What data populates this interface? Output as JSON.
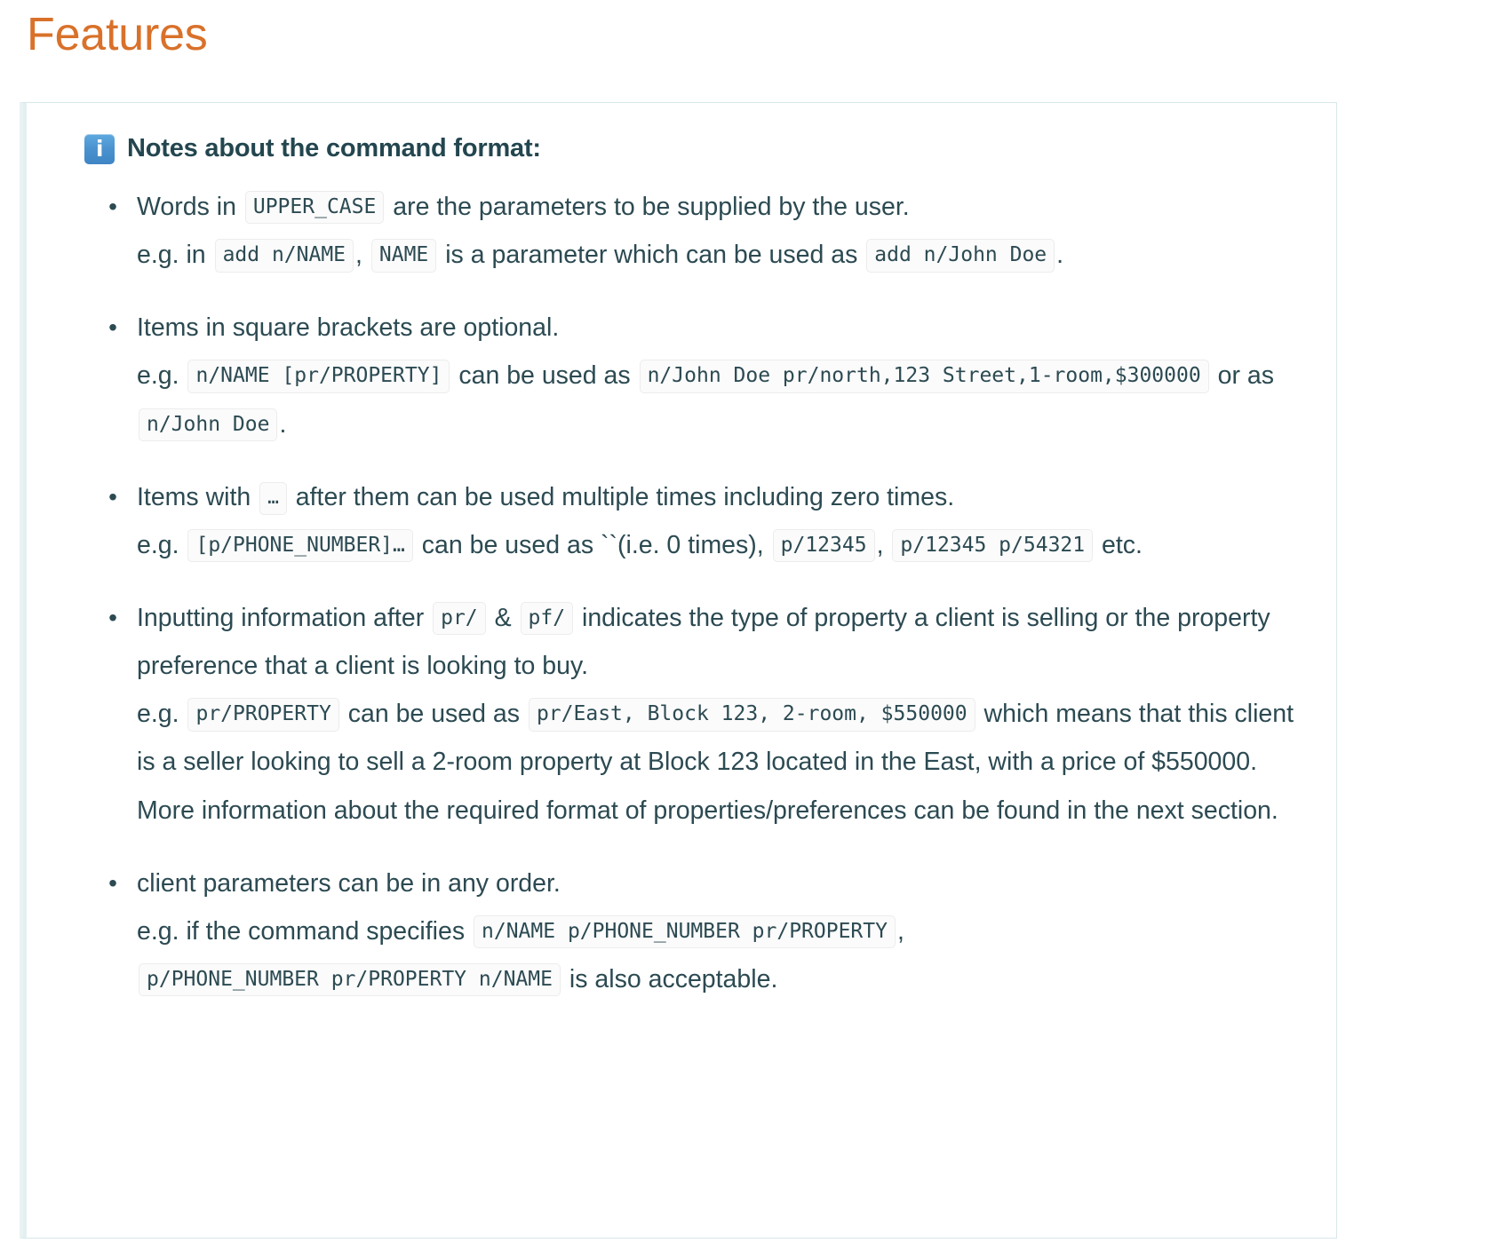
{
  "page_title": "Features",
  "callout": {
    "icon": "info-icon",
    "icon_glyph": "i",
    "title": "Notes about the command format:",
    "accent_color": "#d9712a",
    "text_color": "#2c4a52",
    "border_color": "#d7e8ea",
    "icon_color": "#4a92cf",
    "notes": [
      {
        "id": "upper-case",
        "lines": [
          {
            "parts": [
              {
                "t": "text",
                "v": "Words in "
              },
              {
                "t": "code",
                "v": "UPPER_CASE"
              },
              {
                "t": "text",
                "v": " are the parameters to be supplied by the user."
              }
            ]
          },
          {
            "parts": [
              {
                "t": "text",
                "v": "e.g. in "
              },
              {
                "t": "code",
                "v": "add n/NAME"
              },
              {
                "t": "text",
                "v": ", "
              },
              {
                "t": "code",
                "v": "NAME"
              },
              {
                "t": "text",
                "v": " is a parameter which can be used as "
              },
              {
                "t": "code",
                "v": "add n/John Doe"
              },
              {
                "t": "text",
                "v": "."
              }
            ]
          }
        ]
      },
      {
        "id": "optional-brackets",
        "lines": [
          {
            "parts": [
              {
                "t": "text",
                "v": "Items in square brackets are optional."
              }
            ]
          },
          {
            "parts": [
              {
                "t": "text",
                "v": "e.g. "
              },
              {
                "t": "code",
                "v": "n/NAME [pr/PROPERTY]"
              },
              {
                "t": "text",
                "v": " can be used as "
              },
              {
                "t": "code",
                "v": "n/John Doe pr/north,123 Street,1-room,$300000"
              },
              {
                "t": "text",
                "v": " or as "
              },
              {
                "t": "code",
                "v": "n/John Doe"
              },
              {
                "t": "text",
                "v": "."
              }
            ]
          }
        ]
      },
      {
        "id": "multiple-times",
        "lines": [
          {
            "parts": [
              {
                "t": "text",
                "v": "Items with "
              },
              {
                "t": "code",
                "v": "…"
              },
              {
                "t": "text",
                "v": " after them can be used multiple times including zero times."
              }
            ]
          },
          {
            "parts": [
              {
                "t": "text",
                "v": "e.g. "
              },
              {
                "t": "code",
                "v": "[p/PHONE_NUMBER]…"
              },
              {
                "t": "text",
                "v": " can be used as ``(i.e. 0 times), "
              },
              {
                "t": "code",
                "v": "p/12345"
              },
              {
                "t": "text",
                "v": ", "
              },
              {
                "t": "code",
                "v": "p/12345 p/54321"
              },
              {
                "t": "text",
                "v": " etc."
              }
            ]
          }
        ]
      },
      {
        "id": "property-prefixes",
        "lines": [
          {
            "parts": [
              {
                "t": "text",
                "v": "Inputting information after "
              },
              {
                "t": "code",
                "v": "pr/"
              },
              {
                "t": "text",
                "v": " & "
              },
              {
                "t": "code",
                "v": "pf/"
              },
              {
                "t": "text",
                "v": " indicates the type of property a client is selling or the property preference that a client is looking to buy."
              }
            ]
          },
          {
            "parts": [
              {
                "t": "text",
                "v": "e.g. "
              },
              {
                "t": "code",
                "v": "pr/PROPERTY"
              },
              {
                "t": "text",
                "v": " can be used as "
              },
              {
                "t": "code",
                "v": "pr/East, Block 123, 2-room, $550000"
              },
              {
                "t": "text",
                "v": " which means that this client is a seller looking to sell a 2-room property at Block 123 located in the East, with a price of $550000."
              }
            ]
          },
          {
            "parts": [
              {
                "t": "text",
                "v": "More information about the required format of properties/preferences can be found in the next section."
              }
            ]
          }
        ]
      },
      {
        "id": "any-order",
        "lines": [
          {
            "parts": [
              {
                "t": "text",
                "v": "client parameters can be in any order."
              }
            ]
          },
          {
            "parts": [
              {
                "t": "text",
                "v": "e.g. if the command specifies "
              },
              {
                "t": "code",
                "v": "n/NAME p/PHONE_NUMBER pr/PROPERTY"
              },
              {
                "t": "text",
                "v": ", "
              },
              {
                "t": "code",
                "v": "p/PHONE_NUMBER pr/PROPERTY n/NAME"
              },
              {
                "t": "text",
                "v": " is also acceptable."
              }
            ]
          }
        ]
      }
    ]
  }
}
